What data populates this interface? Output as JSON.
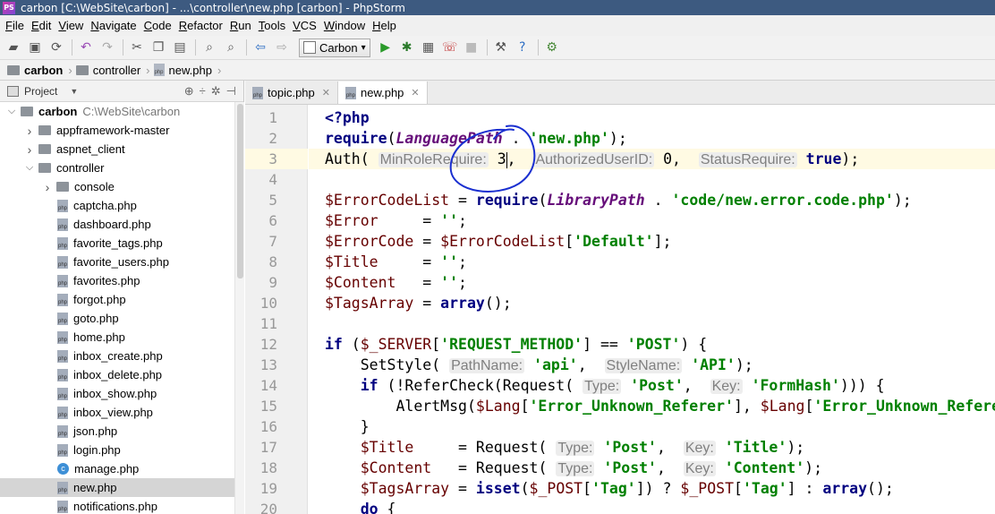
{
  "window": {
    "title": "carbon [C:\\WebSite\\carbon] - ...\\controller\\new.php [carbon] - PhpStorm",
    "app_icon": "PS"
  },
  "menu": [
    "File",
    "Edit",
    "View",
    "Navigate",
    "Code",
    "Refactor",
    "Run",
    "Tools",
    "VCS",
    "Window",
    "Help"
  ],
  "toolbar": {
    "run_config": "Carbon",
    "icons": [
      "open-folder-icon",
      "save-icon",
      "sync-icon",
      "undo-icon",
      "redo-icon",
      "cut-icon",
      "copy-icon",
      "paste-icon",
      "find-icon",
      "replace-icon",
      "back-icon",
      "forward-icon",
      "run-icon",
      "debug-icon",
      "coverage-icon",
      "debug-listen-icon",
      "stop-icon",
      "settings-icon",
      "help-icon",
      "plugin-icon"
    ]
  },
  "breadcrumb": [
    "carbon",
    "controller",
    "new.php"
  ],
  "project_panel": {
    "title": "Project",
    "tree": [
      {
        "label": "carbon",
        "path": "C:\\WebSite\\carbon",
        "kind": "folder",
        "level": 0,
        "expanded": true,
        "bold": true
      },
      {
        "label": "appframework-master",
        "kind": "folder",
        "level": 1,
        "expanded": false
      },
      {
        "label": "aspnet_client",
        "kind": "folder",
        "level": 1,
        "expanded": false
      },
      {
        "label": "controller",
        "kind": "folder",
        "level": 1,
        "expanded": true
      },
      {
        "label": "console",
        "kind": "folder",
        "level": 2,
        "expanded": false
      },
      {
        "label": "captcha.php",
        "kind": "php",
        "level": 2
      },
      {
        "label": "dashboard.php",
        "kind": "php",
        "level": 2
      },
      {
        "label": "favorite_tags.php",
        "kind": "php",
        "level": 2
      },
      {
        "label": "favorite_users.php",
        "kind": "php",
        "level": 2
      },
      {
        "label": "favorites.php",
        "kind": "php",
        "level": 2
      },
      {
        "label": "forgot.php",
        "kind": "php",
        "level": 2
      },
      {
        "label": "goto.php",
        "kind": "php",
        "level": 2
      },
      {
        "label": "home.php",
        "kind": "php",
        "level": 2
      },
      {
        "label": "inbox_create.php",
        "kind": "php",
        "level": 2
      },
      {
        "label": "inbox_delete.php",
        "kind": "php",
        "level": 2
      },
      {
        "label": "inbox_show.php",
        "kind": "php",
        "level": 2
      },
      {
        "label": "inbox_view.php",
        "kind": "php",
        "level": 2
      },
      {
        "label": "json.php",
        "kind": "php",
        "level": 2
      },
      {
        "label": "login.php",
        "kind": "php",
        "level": 2
      },
      {
        "label": "manage.php",
        "kind": "class",
        "level": 2
      },
      {
        "label": "new.php",
        "kind": "php",
        "level": 2,
        "selected": true
      },
      {
        "label": "notifications.php",
        "kind": "php",
        "level": 2
      }
    ]
  },
  "editor": {
    "tabs": [
      {
        "label": "topic.php",
        "active": false
      },
      {
        "label": "new.php",
        "active": true
      }
    ],
    "current_line": 3,
    "lines": [
      {
        "n": "1",
        "tokens": [
          [
            "kw",
            "<?php"
          ]
        ]
      },
      {
        "n": "2",
        "tokens": [
          [
            "kw",
            "require"
          ],
          [
            "",
            "("
          ],
          [
            "const",
            "LanguagePath"
          ],
          [
            "",
            " . "
          ],
          [
            "str",
            "'new.php'"
          ],
          [
            "",
            ");"
          ]
        ]
      },
      {
        "n": "3",
        "tokens": [
          [
            "",
            "Auth( "
          ],
          [
            "hint",
            "MinRoleRequire:"
          ],
          [
            "",
            " 3"
          ],
          [
            "caret",
            ""
          ],
          [
            "",
            ",  "
          ],
          [
            "hint",
            "AuthorizedUserID:"
          ],
          [
            "",
            " 0,  "
          ],
          [
            "hint",
            "StatusRequire:"
          ],
          [
            "",
            " "
          ],
          [
            "kw",
            "true"
          ],
          [
            "",
            ");"
          ]
        ]
      },
      {
        "n": "4",
        "tokens": []
      },
      {
        "n": "5",
        "tokens": [
          [
            "var",
            "$ErrorCodeList"
          ],
          [
            "",
            " = "
          ],
          [
            "kw",
            "require"
          ],
          [
            "",
            "("
          ],
          [
            "const",
            "LibraryPath"
          ],
          [
            "",
            " . "
          ],
          [
            "str",
            "'code/new.error.code.php'"
          ],
          [
            "",
            ");"
          ]
        ]
      },
      {
        "n": "6",
        "tokens": [
          [
            "var",
            "$Error"
          ],
          [
            "",
            "     = "
          ],
          [
            "str",
            "''"
          ],
          [
            "",
            ";"
          ]
        ]
      },
      {
        "n": "7",
        "tokens": [
          [
            "var",
            "$ErrorCode"
          ],
          [
            "",
            " = "
          ],
          [
            "var",
            "$ErrorCodeList"
          ],
          [
            "",
            "["
          ],
          [
            "str",
            "'Default'"
          ],
          [
            "",
            "];"
          ]
        ]
      },
      {
        "n": "8",
        "tokens": [
          [
            "var",
            "$Title"
          ],
          [
            "",
            "     = "
          ],
          [
            "str",
            "''"
          ],
          [
            "",
            ";"
          ]
        ]
      },
      {
        "n": "9",
        "tokens": [
          [
            "var",
            "$Content"
          ],
          [
            "",
            "   = "
          ],
          [
            "str",
            "''"
          ],
          [
            "",
            ";"
          ]
        ]
      },
      {
        "n": "10",
        "tokens": [
          [
            "var",
            "$TagsArray"
          ],
          [
            "",
            " = "
          ],
          [
            "kw",
            "array"
          ],
          [
            "",
            "();"
          ]
        ]
      },
      {
        "n": "11",
        "tokens": []
      },
      {
        "n": "12",
        "tokens": [
          [
            "kw",
            "if"
          ],
          [
            "",
            " ("
          ],
          [
            "var",
            "$_SERVER"
          ],
          [
            "",
            "["
          ],
          [
            "str",
            "'REQUEST_METHOD'"
          ],
          [
            "",
            "] == "
          ],
          [
            "str",
            "'POST'"
          ],
          [
            "",
            ") {"
          ]
        ]
      },
      {
        "n": "13",
        "tokens": [
          [
            "",
            "    SetStyle( "
          ],
          [
            "hint",
            "PathName:"
          ],
          [
            "",
            " "
          ],
          [
            "str",
            "'api'"
          ],
          [
            "",
            ",  "
          ],
          [
            "hint",
            "StyleName:"
          ],
          [
            "",
            " "
          ],
          [
            "str",
            "'API'"
          ],
          [
            "",
            ");"
          ]
        ]
      },
      {
        "n": "14",
        "tokens": [
          [
            "",
            "    "
          ],
          [
            "kw",
            "if"
          ],
          [
            "",
            " (!ReferCheck(Request( "
          ],
          [
            "hint",
            "Type:"
          ],
          [
            "",
            " "
          ],
          [
            "str",
            "'Post'"
          ],
          [
            "",
            ",  "
          ],
          [
            "hint",
            "Key:"
          ],
          [
            "",
            " "
          ],
          [
            "str",
            "'FormHash'"
          ],
          [
            "",
            "))) {"
          ]
        ]
      },
      {
        "n": "15",
        "tokens": [
          [
            "",
            "        AlertMsg("
          ],
          [
            "var",
            "$Lang"
          ],
          [
            "",
            "["
          ],
          [
            "str",
            "'Error_Unknown_Referer'"
          ],
          [
            "",
            "], "
          ],
          [
            "var",
            "$Lang"
          ],
          [
            "",
            "["
          ],
          [
            "str",
            "'Error_Unknown_Referer'"
          ],
          [
            "",
            "]);"
          ]
        ]
      },
      {
        "n": "16",
        "tokens": [
          [
            "",
            "    }"
          ]
        ]
      },
      {
        "n": "17",
        "tokens": [
          [
            "",
            "    "
          ],
          [
            "var",
            "$Title"
          ],
          [
            "",
            "     = Request( "
          ],
          [
            "hint",
            "Type:"
          ],
          [
            "",
            " "
          ],
          [
            "str",
            "'Post'"
          ],
          [
            "",
            ",  "
          ],
          [
            "hint",
            "Key:"
          ],
          [
            "",
            " "
          ],
          [
            "str",
            "'Title'"
          ],
          [
            "",
            ");"
          ]
        ]
      },
      {
        "n": "18",
        "tokens": [
          [
            "",
            "    "
          ],
          [
            "var",
            "$Content"
          ],
          [
            "",
            "   = Request( "
          ],
          [
            "hint",
            "Type:"
          ],
          [
            "",
            " "
          ],
          [
            "str",
            "'Post'"
          ],
          [
            "",
            ",  "
          ],
          [
            "hint",
            "Key:"
          ],
          [
            "",
            " "
          ],
          [
            "str",
            "'Content'"
          ],
          [
            "",
            ");"
          ]
        ]
      },
      {
        "n": "19",
        "tokens": [
          [
            "",
            "    "
          ],
          [
            "var",
            "$TagsArray"
          ],
          [
            "",
            " = "
          ],
          [
            "kw",
            "isset"
          ],
          [
            "",
            "("
          ],
          [
            "var",
            "$_POST"
          ],
          [
            "",
            "["
          ],
          [
            "str",
            "'Tag'"
          ],
          [
            "",
            "]) ? "
          ],
          [
            "var",
            "$_POST"
          ],
          [
            "",
            "["
          ],
          [
            "str",
            "'Tag'"
          ],
          [
            "",
            "] : "
          ],
          [
            "kw",
            "array"
          ],
          [
            "",
            "();"
          ]
        ]
      },
      {
        "n": "20",
        "tokens": [
          [
            "",
            "    "
          ],
          [
            "kw",
            "do"
          ],
          [
            "",
            " {"
          ]
        ]
      }
    ],
    "fold_markers": [
      "12",
      "14",
      "16",
      "20"
    ]
  },
  "colors": {
    "keyword": "#000080",
    "string": "#008000",
    "constant": "#660e7a",
    "variable": "#660000",
    "hint": "#808080",
    "current_line": "#fffae3",
    "scribble": "#1a2fd0"
  }
}
